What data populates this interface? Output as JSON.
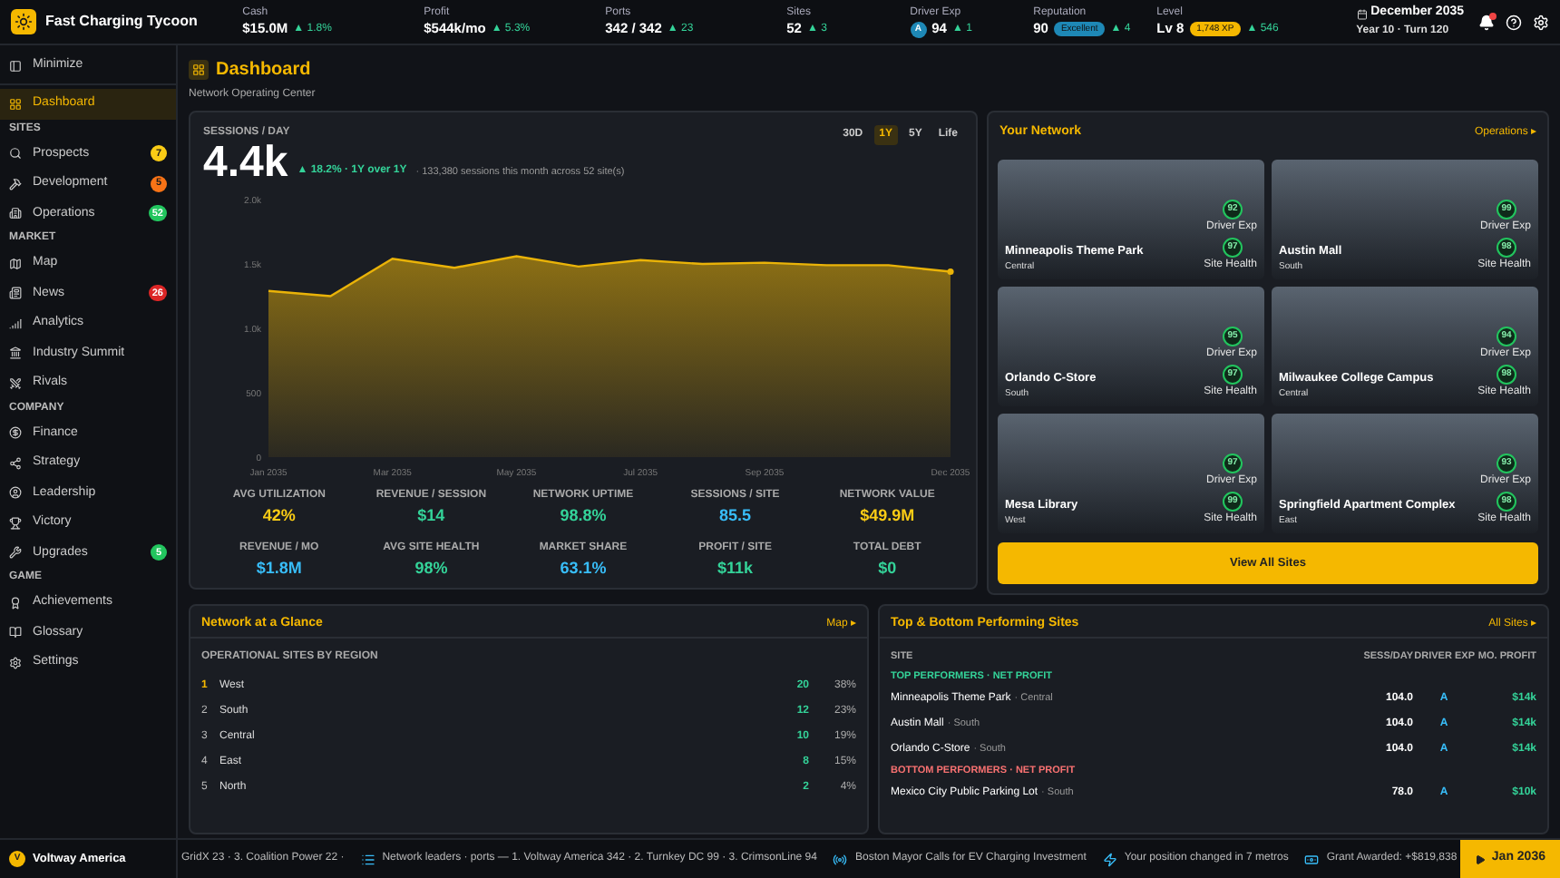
{
  "app": {
    "title": "Fast Charging Tycoon"
  },
  "stats": [
    {
      "label": "Cash",
      "value": "$15.0M",
      "delta": "▲ 1.8%"
    },
    {
      "label": "Profit",
      "value": "$544k/mo",
      "delta": "▲ 5.3%"
    },
    {
      "label": "Ports",
      "value": "342 / 342",
      "delta": "▲ 23"
    },
    {
      "label": "Sites",
      "value": "52",
      "delta": "▲ 3"
    },
    {
      "label": "Driver Exp",
      "grade": "A",
      "value": "94",
      "delta": "▲ 1"
    },
    {
      "label": "Reputation",
      "value": "90",
      "tag": {
        "text": "Excellent",
        "color": "#1e88b6"
      },
      "delta": "▲ 4"
    },
    {
      "label": "Level",
      "value": "Lv 8",
      "tag": {
        "text": "1,748 XP",
        "color": "#f5b800"
      },
      "delta": "▲ 546"
    }
  ],
  "date": {
    "month": "December 2035",
    "turn": "Year 10 · Turn 120"
  },
  "notifications": {
    "unread": true
  },
  "sidebar": {
    "minimize": "Minimize",
    "sections": [
      {
        "items": [
          {
            "label": "Dashboard",
            "selected": true
          }
        ]
      },
      {
        "title": "SITES",
        "items": [
          {
            "label": "Prospects",
            "selected": false,
            "badge": "7",
            "color": "#facc15"
          },
          {
            "label": "Development",
            "selected": false,
            "badge": "5",
            "color": "#f97316"
          },
          {
            "label": "Operations",
            "selected": false,
            "badge": "52",
            "color": "#22c55e"
          }
        ]
      },
      {
        "title": "MARKET",
        "items": [
          {
            "label": "Map",
            "selected": false
          },
          {
            "label": "News",
            "selected": false,
            "badge": "26",
            "color": "#dc2626"
          },
          {
            "label": "Analytics",
            "selected": false
          },
          {
            "label": "Industry Summit",
            "selected": false
          },
          {
            "label": "Rivals",
            "selected": false
          }
        ]
      },
      {
        "title": "COMPANY",
        "items": [
          {
            "label": "Finance",
            "selected": false
          },
          {
            "label": "Strategy",
            "selected": false
          },
          {
            "label": "Leadership",
            "selected": false
          },
          {
            "label": "Victory",
            "selected": false
          },
          {
            "label": "Upgrades",
            "selected": false,
            "badge": "5",
            "color": "#22c55e"
          }
        ]
      },
      {
        "title": "GAME",
        "items": [
          {
            "label": "Achievements",
            "selected": false
          },
          {
            "label": "Glossary",
            "selected": false
          },
          {
            "label": "Settings",
            "selected": false
          }
        ]
      }
    ]
  },
  "page": {
    "title": "Dashboard",
    "subtitle": "Network Operating Center"
  },
  "sessions": {
    "label": "SESSIONS / DAY",
    "value": "4.4k",
    "change": "▲ 18.2% · 1Y over 1Y",
    "note": "· 133,380 sessions this month across 52 site(s)",
    "ranges": [
      {
        "label": "30D",
        "selected": false
      },
      {
        "label": "1Y",
        "selected": true
      },
      {
        "label": "5Y",
        "selected": false
      },
      {
        "label": "Life",
        "selected": false
      }
    ],
    "chart_data": {
      "type": "area",
      "categories": [
        "Jan 2035",
        null,
        "Mar 2035",
        null,
        "May 2035",
        null,
        "Jul 2035",
        null,
        "Sep 2035",
        null,
        null,
        "Dec 2035"
      ],
      "series": [
        {
          "color": "#eab308",
          "values": [
            1290,
            1250,
            1540,
            1470,
            1560,
            1480,
            1530,
            1500,
            1510,
            1490,
            1490,
            1440
          ]
        }
      ],
      "ylim": [
        0,
        2000
      ],
      "yticks": [
        {
          "value": 0,
          "label": "0"
        },
        {
          "value": 500,
          "label": "500"
        },
        {
          "value": 1000,
          "label": "1.0k"
        },
        {
          "value": 1500,
          "label": "1.5k"
        },
        {
          "value": 2000,
          "label": "2.0k"
        }
      ]
    },
    "metrics": [
      {
        "label": "AVG UTILIZATION",
        "value": "42%",
        "color": "#facc15"
      },
      {
        "label": "REVENUE / SESSION",
        "value": "$14",
        "color": "#34d399"
      },
      {
        "label": "NETWORK UPTIME",
        "value": "98.8%",
        "color": "#34d399"
      },
      {
        "label": "SESSIONS / SITE",
        "value": "85.5",
        "color": "#38bdf8"
      },
      {
        "label": "NETWORK VALUE",
        "value": "$49.9M",
        "color": "#facc15"
      },
      {
        "label": "REVENUE / MO",
        "value": "$1.8M",
        "color": "#38bdf8"
      },
      {
        "label": "AVG SITE HEALTH",
        "value": "98%",
        "color": "#34d399"
      },
      {
        "label": "MARKET SHARE",
        "value": "63.1%",
        "color": "#38bdf8"
      },
      {
        "label": "PROFIT / SITE",
        "value": "$11k",
        "color": "#34d399"
      },
      {
        "label": "TOTAL DEBT",
        "value": "$0",
        "color": "#34d399"
      }
    ]
  },
  "network": {
    "title": "Your Network",
    "link": "Operations ▸",
    "button": "View All Sites",
    "sites": [
      {
        "name": "Minneapolis Theme Park",
        "region": "Central",
        "driver_exp": "92",
        "exp_label": "Driver Exp",
        "site_health": "97",
        "health_label": "Site Health"
      },
      {
        "name": "Austin Mall",
        "region": "South",
        "driver_exp": "99",
        "exp_label": "Driver Exp",
        "site_health": "98",
        "health_label": "Site Health"
      },
      {
        "name": "Orlando C-Store",
        "region": "South",
        "driver_exp": "95",
        "exp_label": "Driver Exp",
        "site_health": "97",
        "health_label": "Site Health"
      },
      {
        "name": "Milwaukee College Campus",
        "region": "Central",
        "driver_exp": "94",
        "exp_label": "Driver Exp",
        "site_health": "98",
        "health_label": "Site Health"
      },
      {
        "name": "Mesa Library",
        "region": "West",
        "driver_exp": "97",
        "exp_label": "Driver Exp",
        "site_health": "99",
        "health_label": "Site Health"
      },
      {
        "name": "Springfield Apartment Complex",
        "region": "East",
        "driver_exp": "93",
        "exp_label": "Driver Exp",
        "site_health": "98",
        "health_label": "Site Health"
      }
    ]
  },
  "glance": {
    "title": "Network at a Glance",
    "link": "Map ▸",
    "subtitle": "OPERATIONAL SITES BY REGION",
    "regions": [
      {
        "rank": "1",
        "name": "West",
        "count": "20",
        "share": "38%",
        "highlighted": true
      },
      {
        "rank": "2",
        "name": "South",
        "count": "12",
        "share": "23%",
        "highlighted": false
      },
      {
        "rank": "3",
        "name": "Central",
        "count": "10",
        "share": "19%",
        "highlighted": false
      },
      {
        "rank": "4",
        "name": "East",
        "count": "8",
        "share": "15%",
        "highlighted": false
      },
      {
        "rank": "5",
        "name": "North",
        "count": "2",
        "share": "4%",
        "highlighted": false
      }
    ]
  },
  "performers": {
    "title": "Top & Bottom Performing Sites",
    "link": "All Sites ▸",
    "columns": [
      "SITE",
      "SESS/DAY",
      "DRIVER EXP",
      "MO. PROFIT"
    ],
    "groups": [
      {
        "kind": "top",
        "title": "TOP PERFORMERS · NET PROFIT",
        "rows": [
          {
            "site": "Minneapolis Theme Park",
            "region": "· Central",
            "sessions": "104.0",
            "exp": "A",
            "profit": "$14k"
          },
          {
            "site": "Austin Mall",
            "region": "· South",
            "sessions": "104.0",
            "exp": "A",
            "profit": "$14k"
          },
          {
            "site": "Orlando C-Store",
            "region": "· South",
            "sessions": "104.0",
            "exp": "A",
            "profit": "$14k"
          }
        ]
      },
      {
        "kind": "bottom",
        "title": "BOTTOM PERFORMERS · NET PROFIT",
        "rows": [
          {
            "site": "Mexico City Public Parking Lot",
            "region": "· South",
            "sessions": "78.0",
            "exp": "A",
            "profit": "$10k"
          }
        ]
      }
    ]
  },
  "footer": {
    "company_initial": "V",
    "company": "Voltway America",
    "ticker": [
      {
        "kind": "text",
        "text": "GridX 23 · 3. Coalition Power 22 ·"
      },
      {
        "kind": "list",
        "text": "Network leaders · ports — 1. Voltway America 342 · 2. Turnkey DC 99 · 3. CrimsonLine 94"
      },
      {
        "kind": "news",
        "text": "Boston Mayor Calls for EV Charging Investment"
      },
      {
        "kind": "alert",
        "text": "Your position changed in 7 metros"
      },
      {
        "kind": "money",
        "text": "Grant Awarded: +$819,838"
      }
    ],
    "next": "Jan 2036"
  }
}
